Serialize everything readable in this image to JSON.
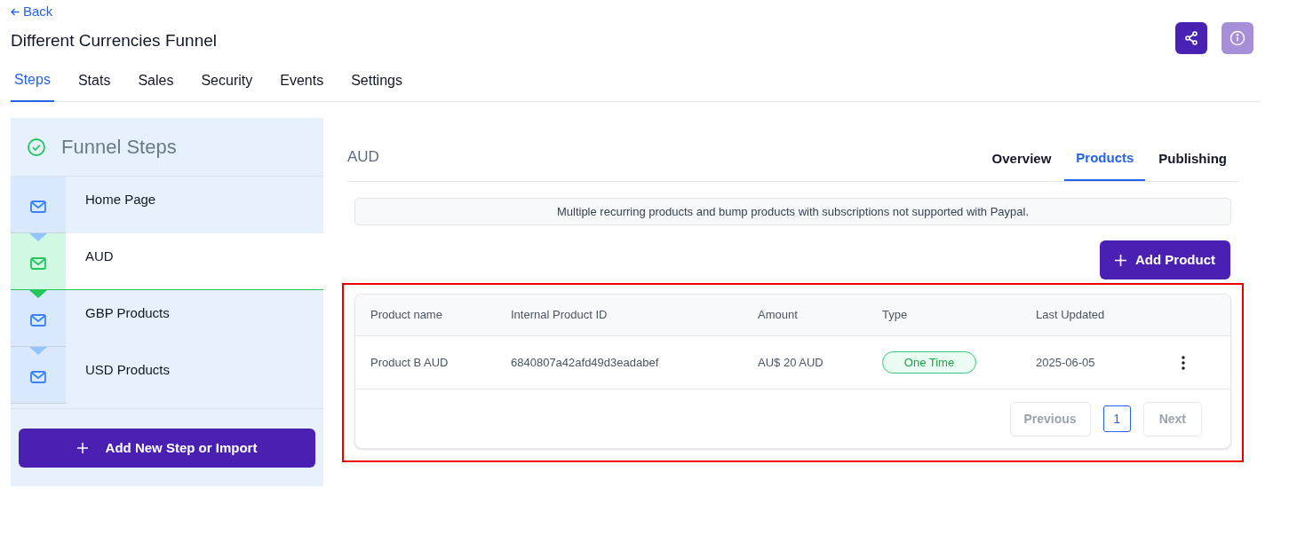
{
  "back_link": "Back",
  "title": "Different Currencies Funnel",
  "header_buttons": [
    {
      "kind": "share",
      "disabled": false
    },
    {
      "kind": "info",
      "disabled": true
    }
  ],
  "tabs": [
    {
      "label": "Steps",
      "selected": true
    },
    {
      "label": "Stats",
      "selected": false
    },
    {
      "label": "Sales",
      "selected": false
    },
    {
      "label": "Security",
      "selected": false
    },
    {
      "label": "Events",
      "selected": false
    },
    {
      "label": "Settings",
      "selected": false
    }
  ],
  "sidebar": {
    "title": "Funnel Steps",
    "steps": [
      {
        "name": "Home Page",
        "selected": false
      },
      {
        "name": "AUD",
        "selected": true
      },
      {
        "name": "GBP Products",
        "selected": false
      },
      {
        "name": "USD Products",
        "selected": false
      }
    ],
    "add_button": "Add New Step or Import"
  },
  "step_title": "AUD",
  "step_tabs": [
    {
      "label": "Overview",
      "selected": false
    },
    {
      "label": "Products",
      "selected": true
    },
    {
      "label": "Publishing",
      "selected": false
    }
  ],
  "notice": "Multiple recurring products and bump products with subscriptions not supported with Paypal.",
  "add_product_button": "Add Product",
  "table": {
    "columns": [
      "Product name",
      "Internal Product ID",
      "Amount",
      "Type",
      "Last Updated"
    ],
    "rows": [
      {
        "name": "Product B AUD",
        "id": "6840807a42afd49d3eadabef",
        "amount": "AU$ 20 AUD",
        "type": "One Time",
        "updated": "2025-06-05"
      }
    ]
  },
  "pagination": {
    "previous": "Previous",
    "pages": [
      {
        "label": "1",
        "selected": true
      }
    ],
    "next": "Next"
  }
}
